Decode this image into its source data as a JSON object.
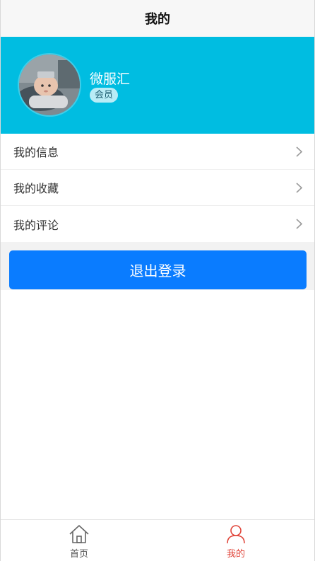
{
  "navbar": {
    "title": "我的"
  },
  "profile": {
    "name": "微服汇",
    "badge": "会员",
    "avatar_icon": "baby-photo-avatar"
  },
  "menu": {
    "items": [
      {
        "label": "我的信息",
        "icon": "chevron-right-icon"
      },
      {
        "label": "我的收藏",
        "icon": "chevron-right-icon"
      },
      {
        "label": "我的评论",
        "icon": "chevron-right-icon"
      }
    ]
  },
  "logout": {
    "label": "退出登录"
  },
  "tabbar": {
    "tabs": [
      {
        "label": "首页",
        "icon": "home-icon",
        "active": false
      },
      {
        "label": "我的",
        "icon": "user-icon",
        "active": true
      }
    ]
  },
  "colors": {
    "profile_bg": "#00bde1",
    "button_bg": "#0a7cff",
    "active_tab": "#e0453a"
  }
}
